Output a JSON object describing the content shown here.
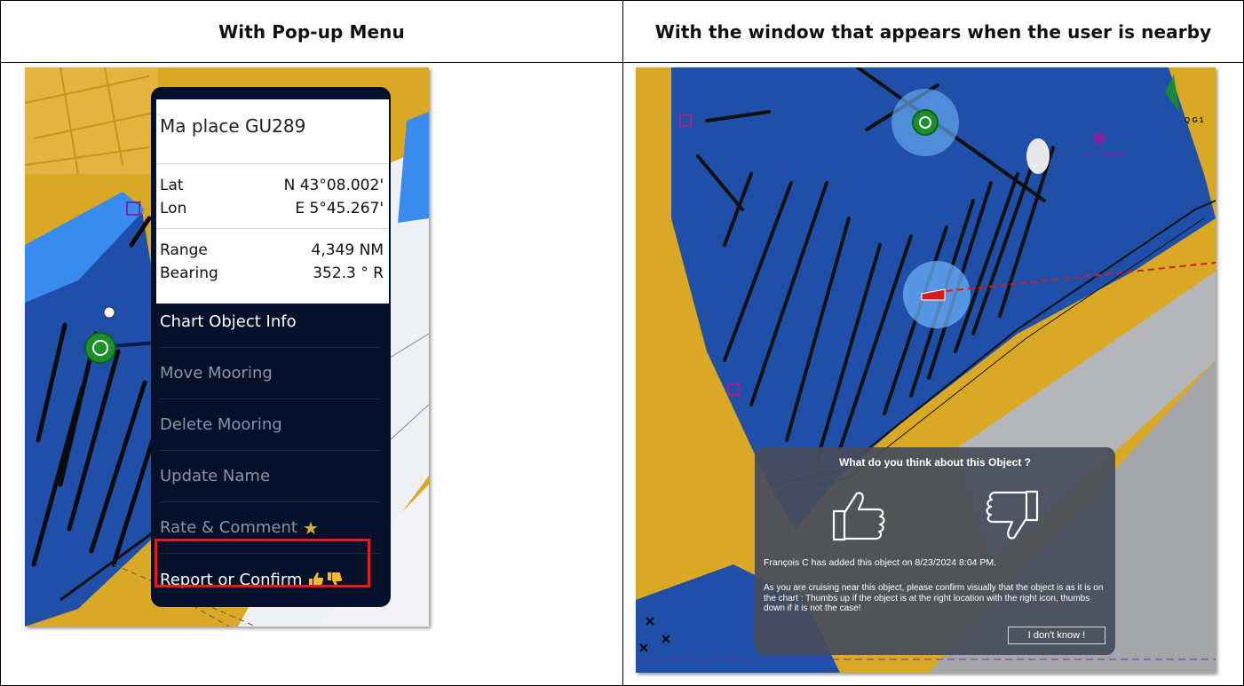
{
  "headers": {
    "left": "With Pop-up Menu",
    "right": "With the window that appears when the user is nearby"
  },
  "popup": {
    "title": "Ma place GU289",
    "lat_label": "Lat",
    "lat_value": "N 43°08.002'",
    "lon_label": "Lon",
    "lon_value": "E 5°45.267'",
    "range_label": "Range",
    "range_value": "4,349 NM",
    "bearing_label": "Bearing",
    "bearing_value": "352.3 ° R",
    "menu": [
      {
        "label": "Chart Object Info",
        "enabled": true
      },
      {
        "label": "Move Mooring",
        "enabled": false
      },
      {
        "label": "Delete Mooring",
        "enabled": false
      },
      {
        "label": "Update Name",
        "enabled": false
      },
      {
        "label": "Rate & Comment",
        "enabled": false
      },
      {
        "label": "Report or Confirm",
        "enabled": true
      }
    ],
    "highlight_color": "#e41b1b"
  },
  "dialog": {
    "title": "What do you think about this Object ?",
    "author_line": "François  C has added this object on 8/23/2024 8:04 PM.",
    "message": "As you are cruising near this object, please confirm visually that the object is as it is on the chart : Thumbs up if the object is at the right location with the right icon, thumbs down if it is not the case!",
    "dont_know_label": "I don't know !"
  },
  "map_labels": {
    "harbor": "Bandol harbor",
    "light": "Q G 1"
  },
  "icons": [
    "star-icon",
    "thumbs-up-icon",
    "thumbs-down-icon",
    "anchor-mooring-icon",
    "boat-icon",
    "parking-icon"
  ],
  "colors": {
    "land": "#d9a825",
    "deep_water": "#1f4fa8",
    "shallow_water": "#3a8bf0",
    "menu_bg": "#05112a",
    "mooring_green": "#1b8f2c"
  }
}
